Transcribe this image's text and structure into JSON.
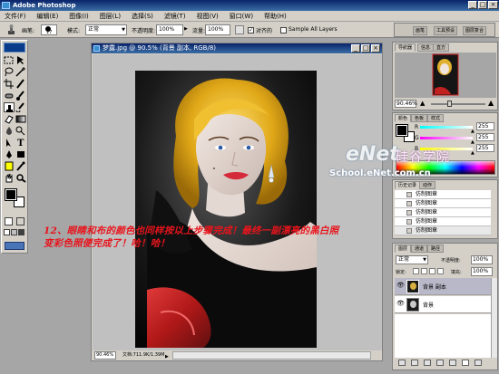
{
  "app": {
    "title": "Adobe Photoshop"
  },
  "menu": {
    "items": [
      "文件(F)",
      "编辑(E)",
      "图像(I)",
      "图层(L)",
      "选择(S)",
      "滤镜(T)",
      "视图(V)",
      "窗口(W)",
      "帮助(H)"
    ]
  },
  "options": {
    "size_label": "画笔:",
    "brush_size": "17",
    "mode_label": "模式:",
    "mode_value": "正常",
    "opacity_label": "不透明度:",
    "opacity_value": "100%",
    "flow_label": "流量:",
    "flow_value": "100%",
    "aligned_label": "对齐的",
    "sample_all_label": "Sample All Layers",
    "well_tabs": [
      "画笔",
      "工具预设",
      "图层复合"
    ]
  },
  "document": {
    "title": "梦露.jpg @ 90.5% (背景 副本, RGB/8)",
    "zoom": "90.46%",
    "status": "文档:711.9K/1.39M"
  },
  "navigator": {
    "tabs": [
      "导航器",
      "信息",
      "直方"
    ],
    "zoom": "90.46%"
  },
  "color": {
    "tabs": [
      "颜色",
      "色板",
      "样式"
    ],
    "channels": [
      {
        "label": "R",
        "value": "255"
      },
      {
        "label": "G",
        "value": "255"
      },
      {
        "label": "B",
        "value": "255"
      }
    ]
  },
  "history": {
    "tabs": [
      "历史记录",
      "动作"
    ],
    "items": [
      "仿制图章",
      "仿制图章",
      "仿制图章",
      "仿制图章",
      "仿制图章"
    ]
  },
  "layers": {
    "tabs": [
      "图层",
      "通道",
      "路径"
    ],
    "mode": "正常",
    "opacity_label": "不透明度:",
    "opacity": "100%",
    "lock_label": "锁定:",
    "fill_label": "填充:",
    "fill": "100%",
    "rows": [
      {
        "name": "背景 副本"
      },
      {
        "name": "背景"
      }
    ]
  },
  "caption": {
    "line1": "12、眼睛和布的颜色也同样按以上步骤完成！最终一副漂亮的黑白照",
    "line2": "变彩色照便完成了！哈！哈！"
  },
  "watermark": {
    "brand": "eNet",
    "brand_cn": "硅谷学院",
    "url": "School.eNet.com.cn"
  }
}
